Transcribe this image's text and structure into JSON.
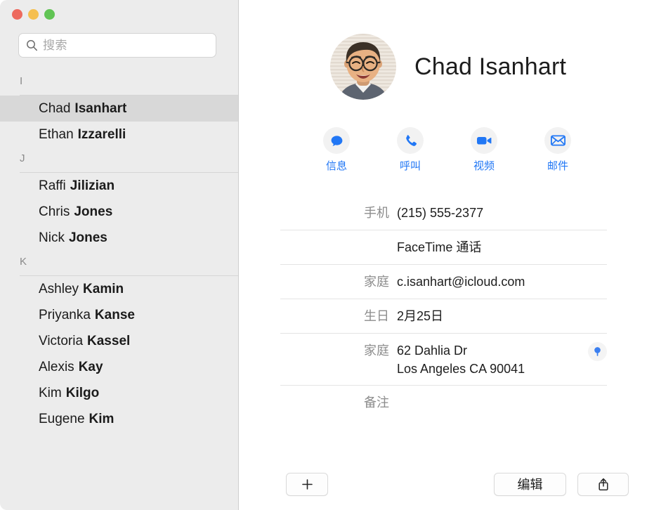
{
  "window": {
    "traffic_lights": [
      {
        "name": "close",
        "color": "#ed6a5e"
      },
      {
        "name": "minimize",
        "color": "#f5bf4f"
      },
      {
        "name": "zoom",
        "color": "#61c454"
      }
    ]
  },
  "sidebar": {
    "search": {
      "placeholder": "搜索",
      "value": "",
      "icon": "search-icon"
    },
    "sections": [
      {
        "letter": "I",
        "contacts": [
          {
            "first": "Chad",
            "last": "Isanhart",
            "selected": true
          },
          {
            "first": "Ethan",
            "last": "Izzarelli",
            "selected": false
          }
        ]
      },
      {
        "letter": "J",
        "contacts": [
          {
            "first": "Raffi",
            "last": "Jilizian",
            "selected": false
          },
          {
            "first": "Chris",
            "last": "Jones",
            "selected": false
          },
          {
            "first": "Nick",
            "last": "Jones",
            "selected": false
          }
        ]
      },
      {
        "letter": "K",
        "contacts": [
          {
            "first": "Ashley",
            "last": "Kamin",
            "selected": false
          },
          {
            "first": "Priyanka",
            "last": "Kanse",
            "selected": false
          },
          {
            "first": "Victoria",
            "last": "Kassel",
            "selected": false
          },
          {
            "first": "Alexis",
            "last": "Kay",
            "selected": false
          },
          {
            "first": "Kim",
            "last": "Kilgo",
            "selected": false
          },
          {
            "first": "Eugene",
            "last": "Kim",
            "selected": false
          }
        ]
      }
    ]
  },
  "detail": {
    "name": "Chad Isanhart",
    "avatar": "contact-photo",
    "actions": [
      {
        "label": "信息",
        "icon": "message-icon"
      },
      {
        "label": "呼叫",
        "icon": "phone-icon"
      },
      {
        "label": "视频",
        "icon": "video-icon"
      },
      {
        "label": "邮件",
        "icon": "mail-icon"
      }
    ],
    "fields": [
      {
        "label": "手机",
        "value": "(215) 555-2377",
        "lines": [
          "(215) 555-2377"
        ]
      },
      {
        "label": "",
        "value": "FaceTime 通话",
        "lines": [
          "FaceTime 通话"
        ]
      },
      {
        "label": "家庭",
        "value": "c.isanhart@icloud.com",
        "lines": [
          "c.isanhart@icloud.com"
        ]
      },
      {
        "label": "生日",
        "value": "2月25日",
        "lines": [
          "2月25日"
        ]
      },
      {
        "label": "家庭",
        "value": "62 Dahlia Dr Los Angeles CA 90041",
        "lines": [
          "62 Dahlia Dr",
          "Los Angeles CA 90041"
        ],
        "map_pin": true
      },
      {
        "label": "备注",
        "value": "",
        "lines": []
      }
    ],
    "toolbar": {
      "add_label": "+",
      "edit_label": "编辑",
      "share_label": "share-icon"
    }
  },
  "colors": {
    "accent_blue": "#2177f5",
    "sidebar_bg": "#ececec",
    "selection_bg": "#d8d8d8",
    "panel_bg": "#ffffff",
    "label_gray": "#8c8c8c",
    "rule_gray": "#e4e4e4"
  }
}
